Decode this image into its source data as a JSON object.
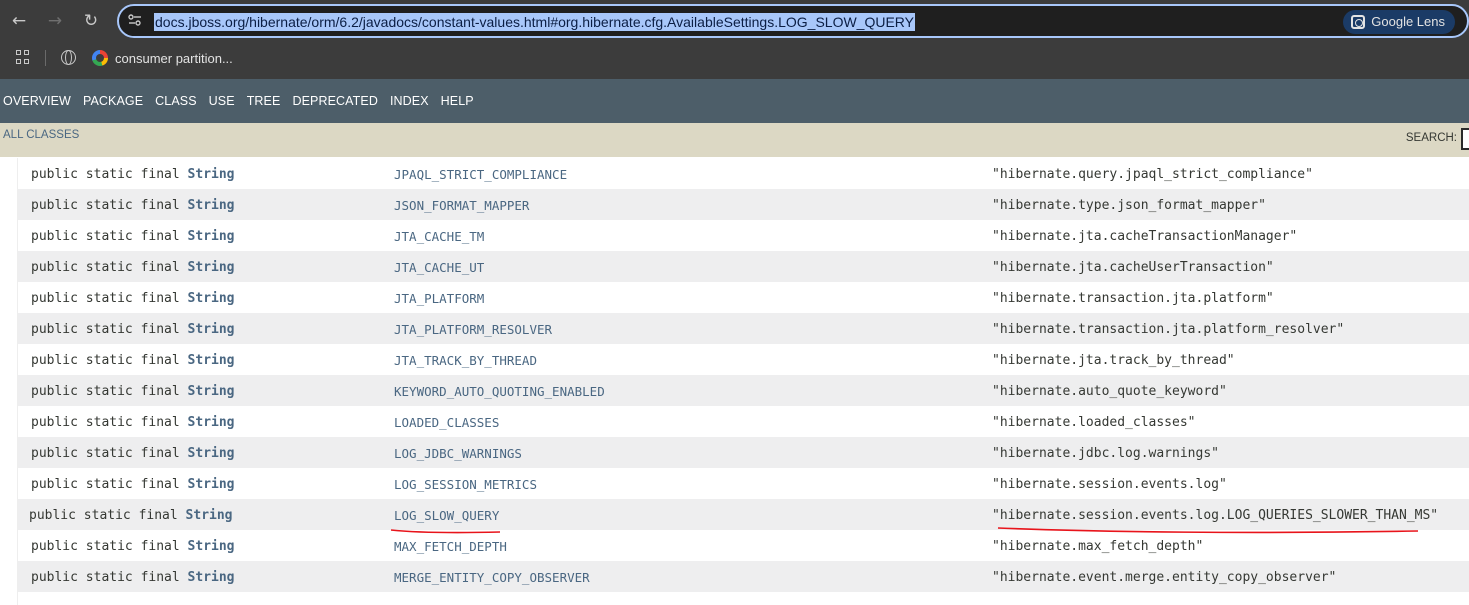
{
  "browser": {
    "url": "docs.jboss.org/hibernate/orm/6.2/javadocs/constant-values.html#org.hibernate.cfg.AvailableSettings.LOG_SLOW_QUERY",
    "lens_label": "Google Lens",
    "bookmark_label": "consumer partition...",
    "icons": [
      "back-icon",
      "forward-icon",
      "reload-icon",
      "site-info-icon",
      "apps-icon",
      "globe-icon",
      "google-icon",
      "lens-icon"
    ]
  },
  "javadoc": {
    "nav": [
      "OVERVIEW",
      "PACKAGE",
      "CLASS",
      "USE",
      "TREE",
      "DEPRECATED",
      "INDEX",
      "HELP"
    ],
    "all_classes": "ALL CLASSES",
    "search_label": "SEARCH:"
  },
  "table": {
    "modifier_prefix": "public static final ",
    "type": "String",
    "rows": [
      {
        "name": "JPAQL_STRICT_COMPLIANCE",
        "value": "\"hibernate.query.jpaql_strict_compliance\""
      },
      {
        "name": "JSON_FORMAT_MAPPER",
        "value": "\"hibernate.type.json_format_mapper\""
      },
      {
        "name": "JTA_CACHE_TM",
        "value": "\"hibernate.jta.cacheTransactionManager\""
      },
      {
        "name": "JTA_CACHE_UT",
        "value": "\"hibernate.jta.cacheUserTransaction\""
      },
      {
        "name": "JTA_PLATFORM",
        "value": "\"hibernate.transaction.jta.platform\""
      },
      {
        "name": "JTA_PLATFORM_RESOLVER",
        "value": "\"hibernate.transaction.jta.platform_resolver\""
      },
      {
        "name": "JTA_TRACK_BY_THREAD",
        "value": "\"hibernate.jta.track_by_thread\""
      },
      {
        "name": "KEYWORD_AUTO_QUOTING_ENABLED",
        "value": "\"hibernate.auto_quote_keyword\""
      },
      {
        "name": "LOADED_CLASSES",
        "value": "\"hibernate.loaded_classes\""
      },
      {
        "name": "LOG_JDBC_WARNINGS",
        "value": "\"hibernate.jdbc.log.warnings\""
      },
      {
        "name": "LOG_SESSION_METRICS",
        "value": "\"hibernate.session.events.log\""
      },
      {
        "name": "LOG_SLOW_QUERY",
        "value": "\"hibernate.session.events.log.LOG_QUERIES_SLOWER_THAN_MS\"",
        "highlighted": true
      },
      {
        "name": "MAX_FETCH_DEPTH",
        "value": "\"hibernate.max_fetch_depth\""
      },
      {
        "name": "MERGE_ENTITY_COPY_OBSERVER",
        "value": "\"hibernate.event.merge.entity_copy_observer\""
      }
    ]
  },
  "colors": {
    "nav_bg": "#4d5e69",
    "subnav_bg": "#dcd8c4",
    "link": "#4a6782",
    "annotation": "#e8141b",
    "url_highlight": "#a8c7fa"
  }
}
